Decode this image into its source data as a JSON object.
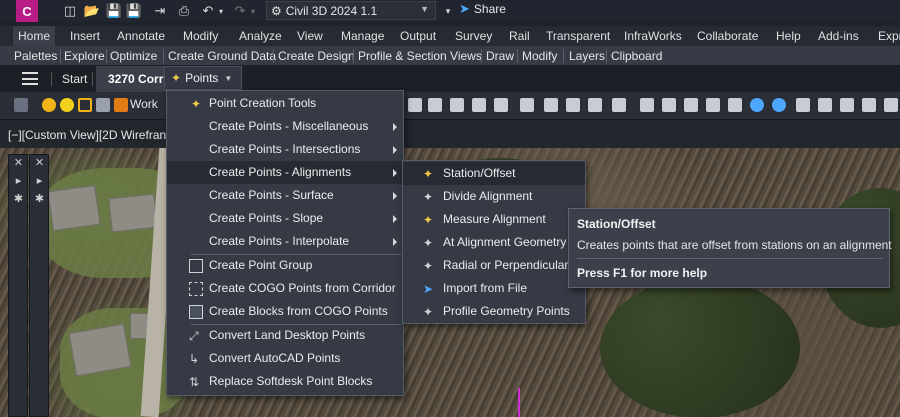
{
  "app": {
    "logo_letter": "C",
    "workspace": "Civil 3D 2024 1.1",
    "share_label": "Share"
  },
  "ribbon": {
    "tabs": [
      "Home",
      "Insert",
      "Annotate",
      "Modify",
      "Analyze",
      "View",
      "Manage",
      "Output",
      "Survey",
      "Rail",
      "Transparent",
      "InfraWorks",
      "Collaborate",
      "Help",
      "Add-ins",
      "Expr"
    ],
    "active_tab": "Home",
    "panels": [
      "Palettes",
      "Explore",
      "Optimize",
      "Create Ground Data",
      "Create Design",
      "Profile & Section Views",
      "Draw",
      "Modify",
      "Layers",
      "Clipboard"
    ]
  },
  "docbar": {
    "start_label": "Start",
    "active_doc": "3270 Corr"
  },
  "points_button": {
    "label": "Points"
  },
  "toolbar": {
    "work_label": "Work"
  },
  "viewport": {
    "label": "[−][Custom View][2D Wirefran"
  },
  "points_menu": {
    "items": [
      {
        "label": "Point Creation Tools",
        "icon": "point-creation-tools-icon",
        "submenu": false
      },
      {
        "label": "Create Points - Miscellaneous",
        "submenu": true
      },
      {
        "label": "Create Points - Intersections",
        "submenu": true
      },
      {
        "label": "Create Points - Alignments",
        "submenu": true,
        "highlighted": true
      },
      {
        "label": "Create Points - Surface",
        "submenu": true
      },
      {
        "label": "Create Points - Slope",
        "submenu": true
      },
      {
        "label": "Create Points - Interpolate",
        "submenu": true
      },
      {
        "label": "Create Point Group",
        "icon": "point-group-icon",
        "submenu": false
      },
      {
        "label": "Create COGO Points from Corridor",
        "icon": "corridor-points-icon",
        "submenu": false
      },
      {
        "label": "Create Blocks from COGO Points",
        "icon": "blocks-from-points-icon",
        "submenu": false
      },
      {
        "label": "Convert Land Desktop Points",
        "icon": "convert-land-desktop-icon",
        "submenu": false
      },
      {
        "label": "Convert AutoCAD Points",
        "icon": "convert-autocad-icon",
        "submenu": false
      },
      {
        "label": "Replace Softdesk Point Blocks",
        "icon": "replace-softdesk-icon",
        "submenu": false
      }
    ]
  },
  "alignments_submenu": {
    "items": [
      {
        "label": "Station/Offset",
        "highlighted": true
      },
      {
        "label": "Divide Alignment"
      },
      {
        "label": "Measure Alignment"
      },
      {
        "label": "At Alignment Geometry"
      },
      {
        "label": "Radial or Perpendicular"
      },
      {
        "label": "Import from File"
      },
      {
        "label": "Profile Geometry Points"
      }
    ]
  },
  "tooltip": {
    "title": "Station/Offset",
    "description": "Creates points that are offset from stations on an alignment",
    "help": "Press F1 for more help"
  },
  "colors": {
    "accent": "#b71d84",
    "share": "#4ea7ff",
    "menu_bg": "#353a45",
    "highlight": "#262a33"
  }
}
